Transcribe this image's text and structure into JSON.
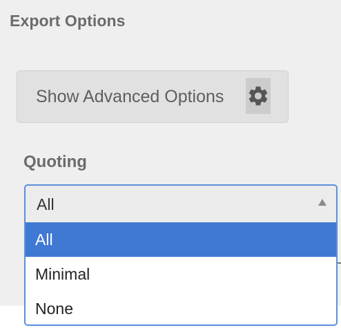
{
  "export": {
    "title": "Export Options",
    "advanced_button_label": "Show Advanced Options",
    "advanced_button_icon": "gear-icon"
  },
  "quoting": {
    "label": "Quoting",
    "selected": "All",
    "options": [
      "All",
      "Minimal",
      "None"
    ]
  },
  "colors": {
    "accent": "#3f79d3",
    "focus_border": "#5b8fd9",
    "panel_bg": "#efefef"
  }
}
